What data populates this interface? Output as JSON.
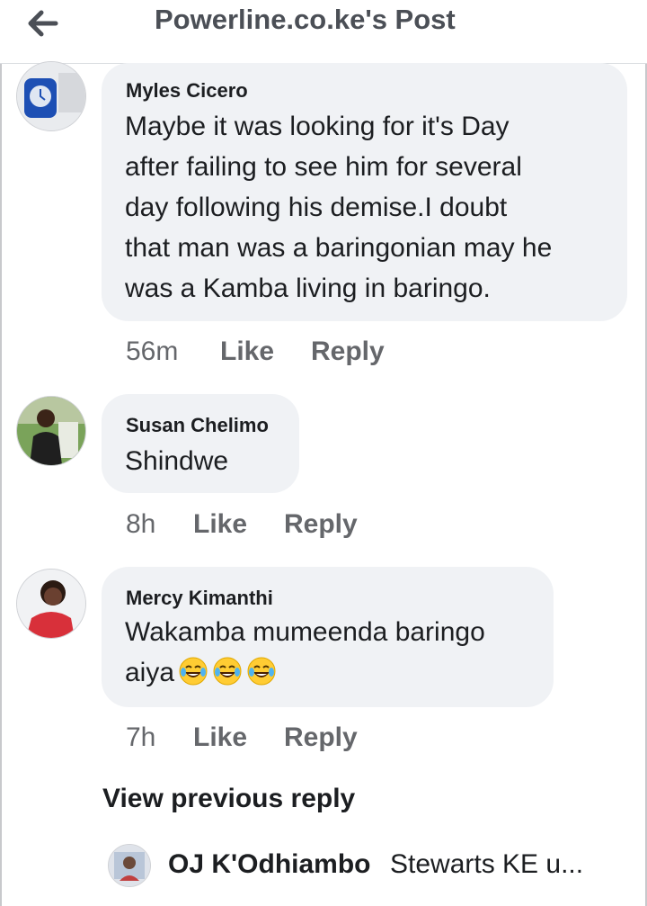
{
  "header": {
    "title": "Powerline.co.ke's Post",
    "back_icon": "arrow-left-icon"
  },
  "comments": [
    {
      "author": "Myles Cicero",
      "lines": [
        "Maybe it was looking for it's Day",
        "after failing to see him for several",
        "day following his demise.I doubt",
        "that man was a baringonian may he",
        "was a Kamba living in baringo."
      ],
      "time": "56m",
      "like": "Like",
      "reply": "Reply"
    },
    {
      "author": "Susan Chelimo",
      "lines": [
        "Shindwe"
      ],
      "time": "8h",
      "like": "Like",
      "reply": "Reply"
    },
    {
      "author": "Mercy Kimanthi",
      "lines": [
        "Wakamba mumeenda baringo",
        "aiya"
      ],
      "emoji": "tears-of-joy-emoji",
      "time": "7h",
      "like": "Like",
      "reply": "Reply"
    }
  ],
  "view_previous": "View previous reply",
  "reply_preview": {
    "author": "OJ K'Odhiambo",
    "text": "Stewarts KE u..."
  }
}
